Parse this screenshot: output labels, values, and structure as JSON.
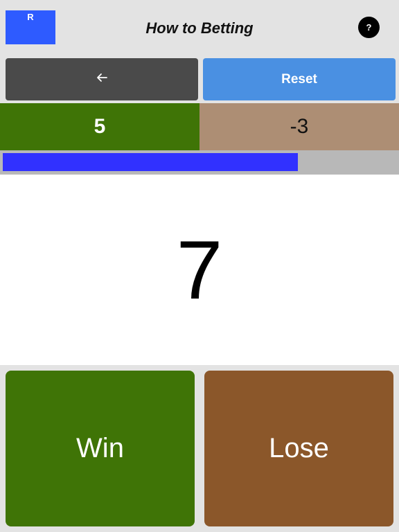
{
  "header": {
    "logo_text": "R",
    "title": "How to Betting",
    "help_label": "?"
  },
  "controls": {
    "back_icon": "arrow-left-icon",
    "reset_label": "Reset"
  },
  "scores": {
    "wins": "5",
    "losses": "-3"
  },
  "progress": {
    "fraction": 0.75
  },
  "main": {
    "number": "7"
  },
  "actions": {
    "win_label": "Win",
    "lose_label": "Lose"
  },
  "colors": {
    "logo": "#2e5bff",
    "back": "#4a4a4a",
    "reset": "#4a90e2",
    "win": "#3f7406",
    "loss_score": "#ad8e74",
    "lose": "#8b572a",
    "progress_fill": "#3131ff",
    "progress_track": "#b8b8b8"
  }
}
